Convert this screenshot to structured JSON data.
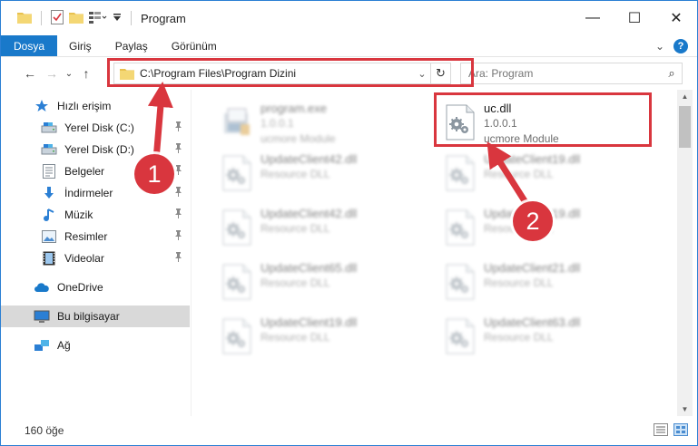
{
  "window": {
    "title": "Program",
    "minimize": "—",
    "maximize": "☐",
    "close": "✕"
  },
  "ribbon": {
    "tabs": [
      "Dosya",
      "Giriş",
      "Paylaş",
      "Görünüm"
    ],
    "expand": "⌄",
    "help": "?"
  },
  "nav": {
    "back": "←",
    "forward": "→",
    "recent": "⌄",
    "up": "↑",
    "address": "C:\\Program Files\\Program Dizini",
    "address_dropdown": "⌄",
    "refresh": "↻",
    "search_placeholder": "Ara: Program",
    "search_icon": "⌕"
  },
  "sidebar": {
    "items": [
      {
        "label": "Hızlı erişim",
        "icon": "star-icon"
      },
      {
        "label": "Yerel Disk (C:)",
        "icon": "drive-icon",
        "pinned": true
      },
      {
        "label": "Yerel Disk (D:)",
        "icon": "drive-icon",
        "pinned": true
      },
      {
        "label": "Belgeler",
        "icon": "documents-icon",
        "pinned": true
      },
      {
        "label": "İndirmeler",
        "icon": "download-icon",
        "pinned": true
      },
      {
        "label": "Müzik",
        "icon": "music-icon",
        "pinned": true
      },
      {
        "label": "Resimler",
        "icon": "pictures-icon",
        "pinned": true
      },
      {
        "label": "Videolar",
        "icon": "video-icon",
        "pinned": true
      },
      {
        "label": "OneDrive",
        "icon": "cloud-icon"
      },
      {
        "label": "Bu bilgisayar",
        "icon": "computer-icon",
        "selected": true
      },
      {
        "label": "Ağ",
        "icon": "network-icon"
      }
    ]
  },
  "files": [
    {
      "name": "program.exe",
      "line2": "1.0.0.1",
      "line3": "ucmore Module",
      "blurred": true,
      "kind": "exe"
    },
    {
      "name": "uc.dll",
      "line2": "1.0.0.1",
      "line3": "ucmore Module",
      "blurred": false,
      "kind": "dll"
    },
    {
      "name": "UpdateClient42.dll",
      "line2": "Resource DLL",
      "blurred": true,
      "kind": "dll"
    },
    {
      "name": "UpdateClient19.dll",
      "line2": "Resource DLL",
      "blurred": true,
      "kind": "dll"
    },
    {
      "name": "UpdateClient42.dll",
      "line2": "Resource DLL",
      "blurred": true,
      "kind": "dll"
    },
    {
      "name": "UpdateClient19.dll",
      "line2": "Resource DLL",
      "blurred": true,
      "kind": "dll"
    },
    {
      "name": "UpdateClient65.dll",
      "line2": "Resource DLL",
      "blurred": true,
      "kind": "dll"
    },
    {
      "name": "UpdateClient21.dll",
      "line2": "Resource DLL",
      "blurred": true,
      "kind": "dll"
    },
    {
      "name": "UpdateClient19.dll",
      "line2": "Resource DLL",
      "blurred": true,
      "kind": "dll"
    },
    {
      "name": "UpdateClient63.dll",
      "line2": "Resource DLL",
      "blurred": true,
      "kind": "dll"
    }
  ],
  "status": {
    "count": "160 öğe"
  },
  "annotations": {
    "step1": "1",
    "step2": "2",
    "color": "#d9363e"
  },
  "colors": {
    "accent": "#1979ca",
    "highlight": "#d9363e",
    "selected_bg": "#d9d9d9"
  }
}
